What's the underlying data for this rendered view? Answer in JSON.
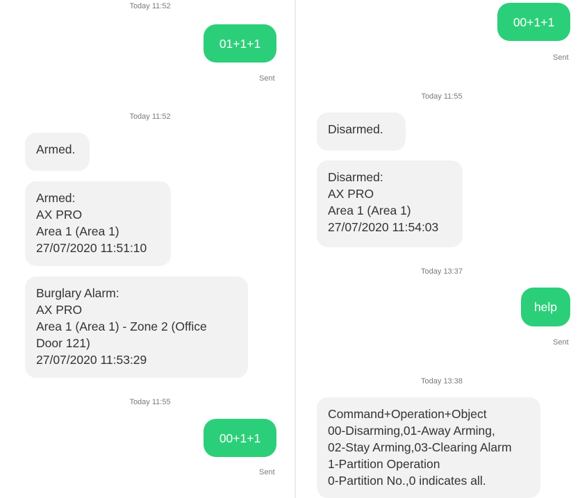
{
  "left": {
    "timestamp_top_cut": "Today 11:52",
    "out1": "01+1+1",
    "sent1": "Sent",
    "timestamp1": "Today 11:52",
    "msg_armed_short": "Armed.",
    "msg_armed_detail": "Armed:\nAX PRO\nArea 1 (Area 1)\n27/07/2020 11:51:10",
    "msg_burglary": "Burglary Alarm:\nAX PRO\nArea 1 (Area 1) - Zone 2 (Office\nDoor 121)\n27/07/2020 11:53:29",
    "timestamp2": "Today 11:55",
    "out2": "00+1+1",
    "sent2": "Sent"
  },
  "right": {
    "out1": "00+1+1",
    "sent1": "Sent",
    "timestamp1": "Today 11:55",
    "msg_disarmed_short": "Disarmed.",
    "msg_disarmed_detail": "Disarmed:\nAX PRO\nArea 1 (Area 1)\n27/07/2020 11:54:03",
    "timestamp2": "Today 13:37",
    "out2": "help",
    "sent2": "Sent",
    "timestamp3": "Today 13:38",
    "msg_help_reply": "Command+Operation+Object\n00-Disarming,01-Away Arming,\n02-Stay Arming,03-Clearing Alarm\n1-Partition Operation\n0-Partition No.,0 indicates all."
  },
  "colors": {
    "outgoing_bubble": "#2ccf79",
    "incoming_bubble": "#f2f2f3",
    "timestamp_text": "#7a7a7a"
  }
}
